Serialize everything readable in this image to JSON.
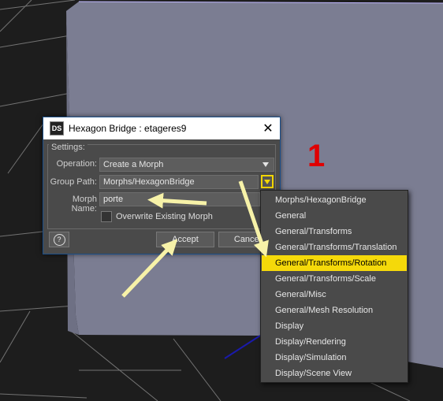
{
  "dialog": {
    "title": "Hexagon Bridge : etageres9",
    "app_icon": "DS",
    "close_glyph": "✕",
    "settings_legend": "Settings:",
    "operation_label": "Operation:",
    "operation_value": "Create a Morph",
    "group_path_label": "Group Path:",
    "group_path_value": "Morphs/HexagonBridge",
    "morph_name_label": "Morph Name:",
    "morph_name_value": "porte",
    "overwrite_label": "Overwrite Existing Morph",
    "help_glyph": "?",
    "accept_label": "Accept",
    "cancel_label": "Cancel"
  },
  "menu": {
    "items": [
      "Morphs/HexagonBridge",
      "General",
      "General/Transforms",
      "General/Transforms/Translation",
      "General/Transforms/Rotation",
      "General/Transforms/Scale",
      "General/Misc",
      "General/Mesh Resolution",
      "Display",
      "Display/Rendering",
      "Display/Simulation",
      "Display/Scene View"
    ],
    "selected": "General/Transforms/Rotation"
  },
  "annotation": {
    "step": "1"
  },
  "colors": {
    "highlight": "#f5d90a",
    "annotation_arrow": "#f7f2a8",
    "step_number": "#e00000",
    "object_face": "#7b7d92"
  },
  "icons": [
    "app-icon",
    "close-icon",
    "help-icon",
    "dropdown-arrow-icon",
    "annotation-arrow"
  ]
}
